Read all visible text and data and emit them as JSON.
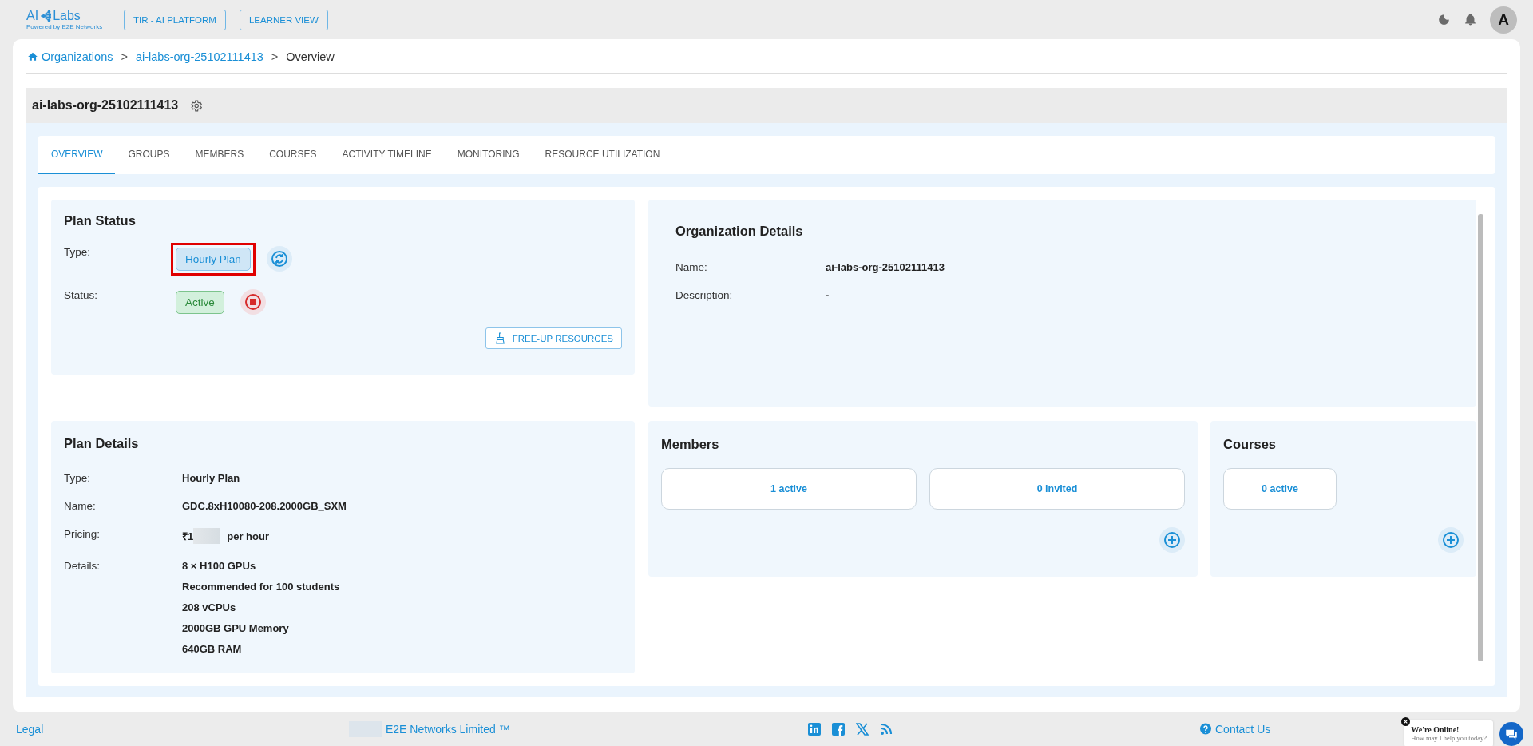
{
  "header": {
    "logo": {
      "left": "AI",
      "right": "Labs",
      "tagline": "Powered by E2E Networks"
    },
    "buttons": [
      "TIR - AI PLATFORM",
      "LEARNER VIEW"
    ],
    "avatar": "A"
  },
  "breadcrumb": [
    {
      "label": "Organizations",
      "link": true
    },
    {
      "separator": ">",
      "label": "ai-labs-org-25102111413",
      "link": true
    },
    {
      "separator": ">",
      "label": "Overview",
      "link": false
    }
  ],
  "org": {
    "title": "ai-labs-org-25102111413"
  },
  "tabs": [
    {
      "label": "OVERVIEW",
      "selected": true
    },
    {
      "label": "GROUPS",
      "selected": false
    },
    {
      "label": "MEMBERS",
      "selected": false
    },
    {
      "label": "COURSES",
      "selected": false
    },
    {
      "label": "ACTIVITY TIMELINE",
      "selected": false
    },
    {
      "label": "MONITORING",
      "selected": false
    },
    {
      "label": "RESOURCE UTILIZATION",
      "selected": false
    }
  ],
  "plan_status": {
    "title": "Plan Status",
    "rows": [
      {
        "label": "Type:",
        "badge": "Hourly Plan",
        "kind": "type",
        "highlighted": true
      },
      {
        "label": "Status:",
        "badge": "Active",
        "kind": "status",
        "highlighted": false
      }
    ],
    "button": "FREE-UP RESOURCES"
  },
  "org_details": {
    "title": "Organization Details",
    "fields": [
      {
        "label": "Name:",
        "value": "ai-labs-org-25102111413"
      },
      {
        "label": "Description:",
        "value": "-"
      }
    ]
  },
  "plan_details": {
    "title": "Plan Details",
    "fields": [
      {
        "label": "Type:",
        "values": [
          "Hourly Plan"
        ]
      },
      {
        "label": "Name:",
        "values": [
          "GDC.8xH10080-208.2000GB_SXM"
        ]
      },
      {
        "label": "Pricing:",
        "values": [
          "₹1"
        ],
        "redacted": true,
        "suffix": "per hour"
      },
      {
        "label": "Details:",
        "values": [
          "8 × H100 GPUs",
          "Recommended for 100 students",
          "208 vCPUs",
          "2000GB GPU Memory",
          "640GB RAM"
        ]
      }
    ]
  },
  "members": {
    "title": "Members",
    "stats": [
      "1 active",
      "0 invited"
    ]
  },
  "courses": {
    "title": "Courses",
    "stats": [
      "0 active"
    ]
  },
  "footer": {
    "legal": "Legal",
    "copyright": "E2E Networks Limited ™",
    "redacted": true,
    "contact": "Contact Us"
  },
  "chat": {
    "title": "We're Online!",
    "subtitle": "How may I help you today?"
  }
}
